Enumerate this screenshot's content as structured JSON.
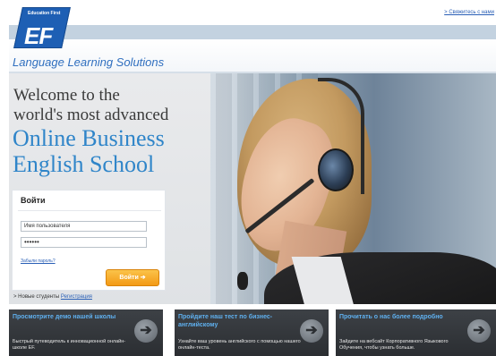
{
  "header": {
    "logo_top_text": "Education First",
    "logo_mark": "EF",
    "contact_link": "> Свяжитесь с нами",
    "tagline": "Language Learning Solutions"
  },
  "hero": {
    "welcome_line_1": "Welcome to the",
    "welcome_line_2": "world's most advanced",
    "headline_line_1": "Online Business",
    "headline_line_2": "English School"
  },
  "login": {
    "title": "Войти",
    "username_value": "Имя пользователя",
    "password_value": "••••••",
    "forgot_link": "Забыли пароль?",
    "submit_label": "Войти ➔",
    "new_students_prefix": "> Новые студенты",
    "register_link": "Регистрация"
  },
  "cards": [
    {
      "title": "Просмотрите демо нашей школы",
      "text": "Быстрый путеводитель к инновационной онлайн-школе EF."
    },
    {
      "title": "Пройдите наш тест по бизнес-английскому",
      "text": "Узнайте ваш уровень английского с помощью нашего онлайн-теста."
    },
    {
      "title": "Прочитать о нас более подробно",
      "text": "Зайдите на вебсайт Корпоративного Языкового Обучения, чтобы узнать больше."
    }
  ],
  "colors": {
    "accent_blue": "#2f85c9",
    "logo_blue": "#1e5fb4",
    "button_orange": "#f39a15",
    "card_dark": "#2b2e32",
    "card_title_blue": "#5fb0ef"
  },
  "icons": {
    "card_arrow": "arrow-right-icon",
    "button_arrow": "arrow-right-icon"
  }
}
